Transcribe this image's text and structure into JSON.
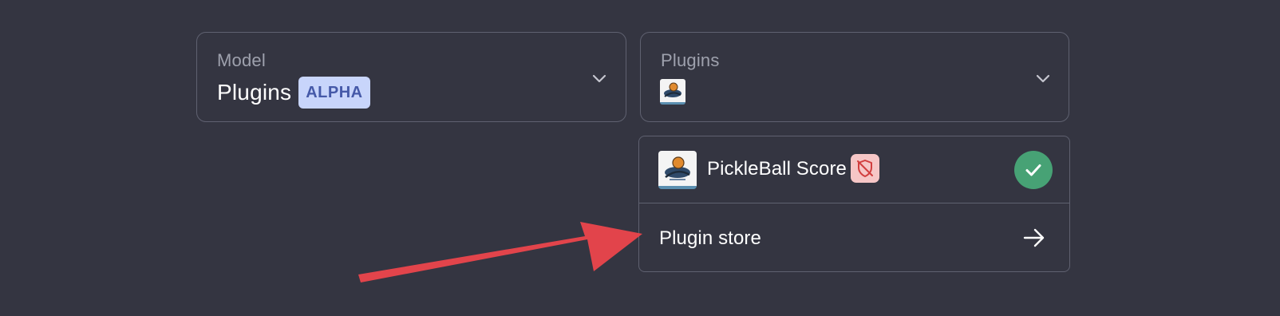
{
  "model_selector": {
    "label": "Model",
    "value": "Plugins",
    "badge": "ALPHA"
  },
  "plugins_selector": {
    "label": "Plugins",
    "selected_icon": "pickleball-logo-icon"
  },
  "dropdown": {
    "plugins": [
      {
        "name": "PickleBall Score",
        "icon": "pickleball-logo-icon",
        "status_icon": "unverified-shield-icon",
        "selected": true
      }
    ],
    "store_label": "Plugin store",
    "store_icon": "arrow-right-icon"
  },
  "colors": {
    "background": "#343541",
    "border": "#5f6170",
    "badge_bg": "#c8d5fb",
    "badge_text": "#4559a8",
    "check_green": "#47a275",
    "unverified_bg": "#f6c6c6",
    "unverified_icon": "#d13e3e",
    "annotation_arrow": "#e2444b"
  }
}
